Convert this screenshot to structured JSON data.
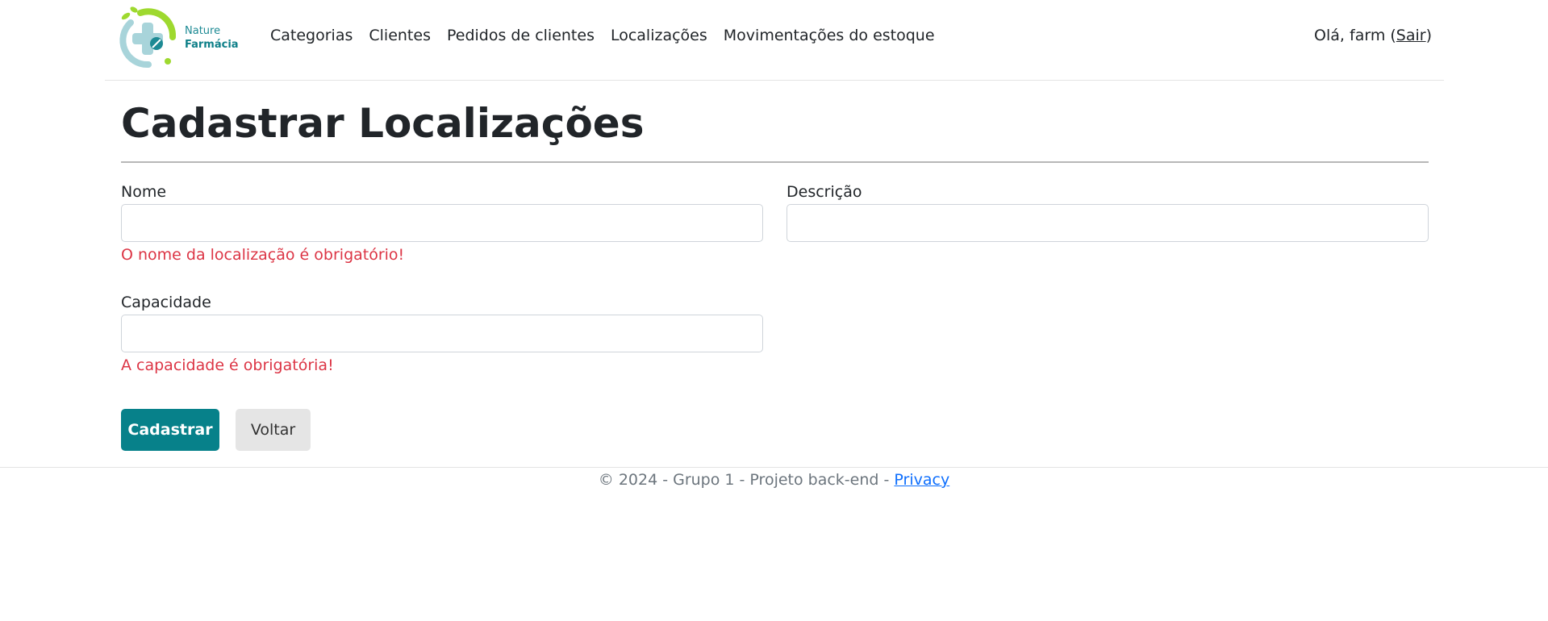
{
  "brand": {
    "line1": "Nature",
    "line2": "Farmácia",
    "colors": {
      "green": "#9ed92f",
      "teal": "#1d8a94",
      "light_teal": "#a8d4da"
    }
  },
  "nav": {
    "items": [
      {
        "label": "Categorias"
      },
      {
        "label": "Clientes"
      },
      {
        "label": "Pedidos de clientes"
      },
      {
        "label": "Localizações"
      },
      {
        "label": "Movimentações do estoque"
      }
    ],
    "greeting_prefix": "Olá, farm (",
    "logout_label": "Sair",
    "greeting_suffix": ")"
  },
  "page": {
    "title": "Cadastrar Localizações"
  },
  "form": {
    "nome": {
      "label": "Nome",
      "value": "",
      "error": "O nome da localização é obrigatório!"
    },
    "descricao": {
      "label": "Descrição",
      "value": ""
    },
    "capacidade": {
      "label": "Capacidade",
      "value": "",
      "error": "A capacidade é obrigatória!"
    },
    "submit_label": "Cadastrar",
    "back_label": "Voltar"
  },
  "footer": {
    "text": "© 2024 - Grupo 1 - Projeto back-end - ",
    "privacy_label": "Privacy"
  },
  "colors": {
    "primary": "#07818a",
    "error": "#dc3545",
    "link": "#0d6efd",
    "muted": "#6c757d"
  }
}
